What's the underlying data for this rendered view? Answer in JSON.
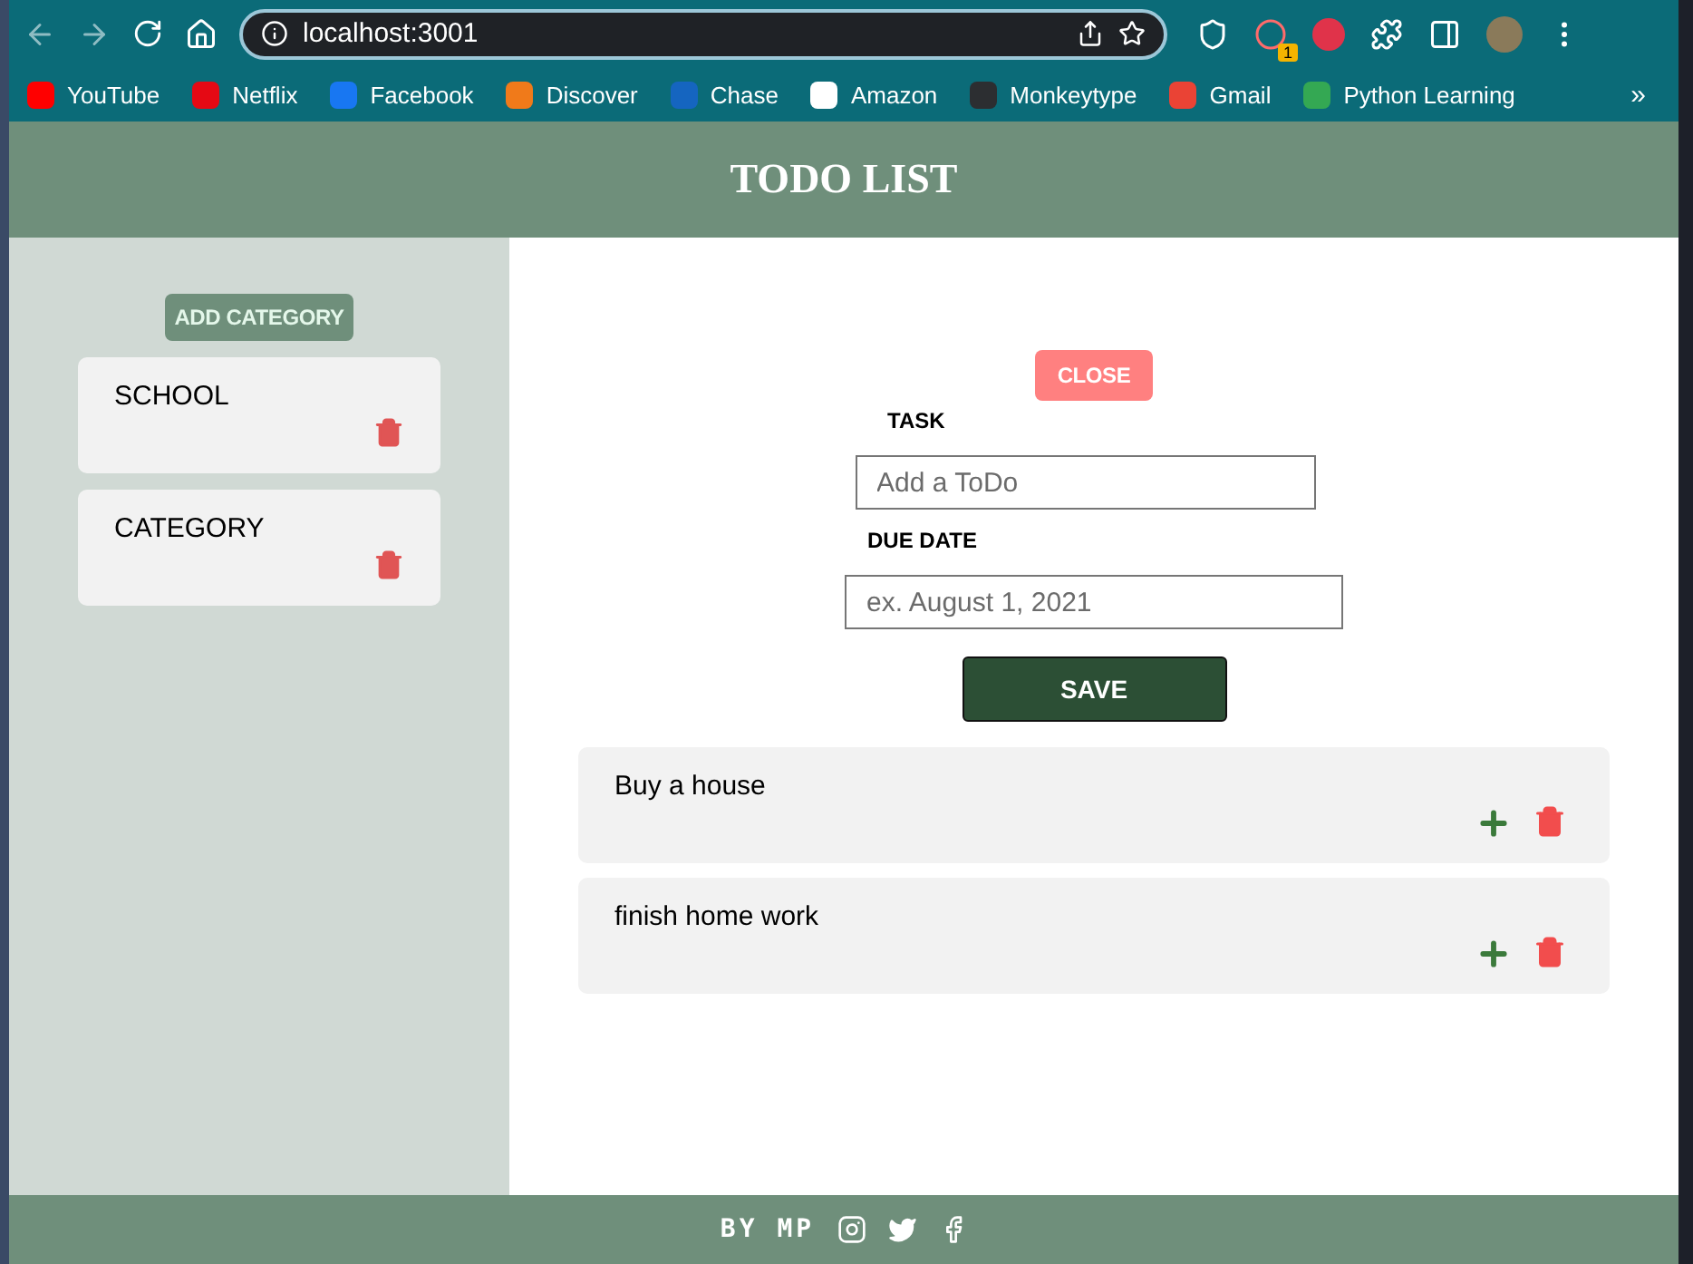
{
  "browser": {
    "url": "localhost:3001",
    "extension_badge": "1",
    "bookmarks": [
      {
        "label": "YouTube",
        "color": "#ff0000"
      },
      {
        "label": "Netflix",
        "color": "#e50914"
      },
      {
        "label": "Facebook",
        "color": "#1877f2"
      },
      {
        "label": "Discover",
        "color": "#f07a1a"
      },
      {
        "label": "Chase",
        "color": "#1565c0"
      },
      {
        "label": "Amazon",
        "color": "#ffffff"
      },
      {
        "label": "Monkeytype",
        "color": "#2c2e31"
      },
      {
        "label": "Gmail",
        "color": "#ea4335"
      },
      {
        "label": "Python Learning",
        "color": "#34a853"
      }
    ],
    "overflow": "»"
  },
  "header": {
    "title": "TODO LIST"
  },
  "sidebar": {
    "add_button": "ADD CATEGORY",
    "categories": [
      {
        "name": "SCHOOL"
      },
      {
        "name": "CATEGORY"
      }
    ]
  },
  "form": {
    "close_button": "CLOSE",
    "fields": [
      {
        "label": "TASK",
        "placeholder": "Add a ToDo"
      },
      {
        "label": "DUE DATE",
        "placeholder": "ex. August 1, 2021"
      }
    ],
    "save_button": "SAVE"
  },
  "todos": [
    {
      "text": "Buy a house"
    },
    {
      "text": "finish home work"
    }
  ],
  "footer": {
    "text": "BY MP"
  }
}
